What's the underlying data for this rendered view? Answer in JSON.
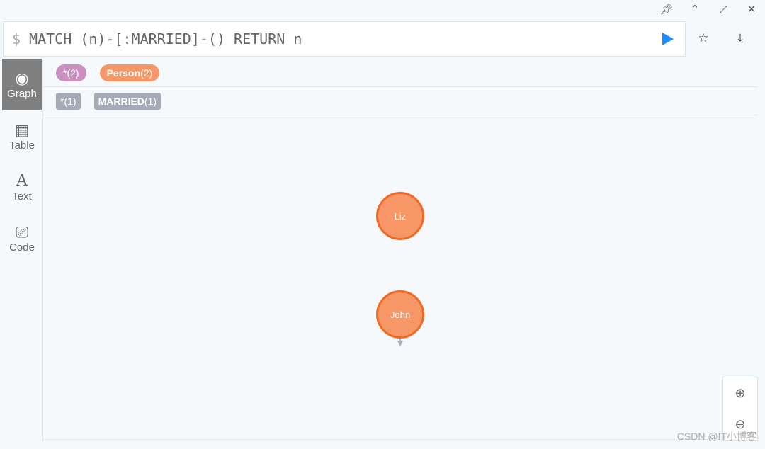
{
  "window_controls": {
    "pin": "pin-icon",
    "collapse": "chevron-up-icon",
    "fullscreen": "expand-icon",
    "close": "close-icon"
  },
  "editor": {
    "prompt": "$",
    "query": "MATCH (n)-[:MARRIED]-() RETURN n"
  },
  "sidebar": {
    "items": [
      {
        "label": "Graph",
        "icon": "graph-icon",
        "active": true
      },
      {
        "label": "Table",
        "icon": "table-icon"
      },
      {
        "label": "Text",
        "icon": "text-icon"
      },
      {
        "label": "Code",
        "icon": "code-icon"
      }
    ]
  },
  "labels": [
    {
      "name": "*",
      "count": "(2)",
      "color": "#c990c0"
    },
    {
      "name": "Person",
      "count": "(2)",
      "color": "#f79767"
    }
  ],
  "rel_types": [
    {
      "name": "*",
      "count": "(1)"
    },
    {
      "name": "MARRIED",
      "count": "(1)"
    }
  ],
  "graph": {
    "nodes": [
      {
        "label": "Liz"
      },
      {
        "label": "John"
      }
    ],
    "edge": {
      "type": "MARRIED",
      "from": "Liz",
      "to": "John"
    }
  },
  "watermark": "CSDN @IT小博客"
}
